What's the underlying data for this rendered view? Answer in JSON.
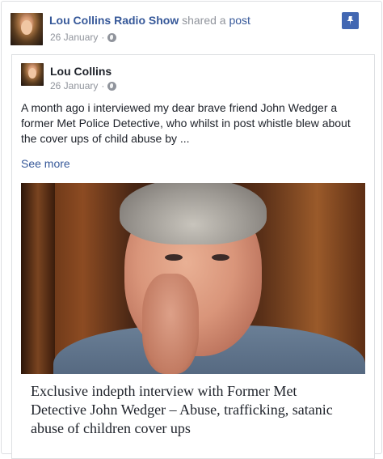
{
  "post": {
    "author": "Lou Collins Radio Show",
    "shared_text": " shared a ",
    "post_link": "post",
    "date": "26 January",
    "dot": "·",
    "icons": {
      "privacy": "globe-icon",
      "pin": "pin-icon"
    },
    "colors": {
      "link": "#365899",
      "meta": "#90949c",
      "pin_bg": "#4267b2"
    }
  },
  "shared": {
    "author": "Lou Collins",
    "date": "26 January",
    "dot": "·",
    "body": "A month ago i interviewed my dear brave friend John Wedger a former Met Police Detective, who whilst in post whistle blew about the cover ups of child abuse by ...",
    "see_more": "See more",
    "article_title": "Exclusive indepth interview with Former Met Detective John Wedger – Abuse, trafficking, satanic abuse of children cover ups"
  }
}
